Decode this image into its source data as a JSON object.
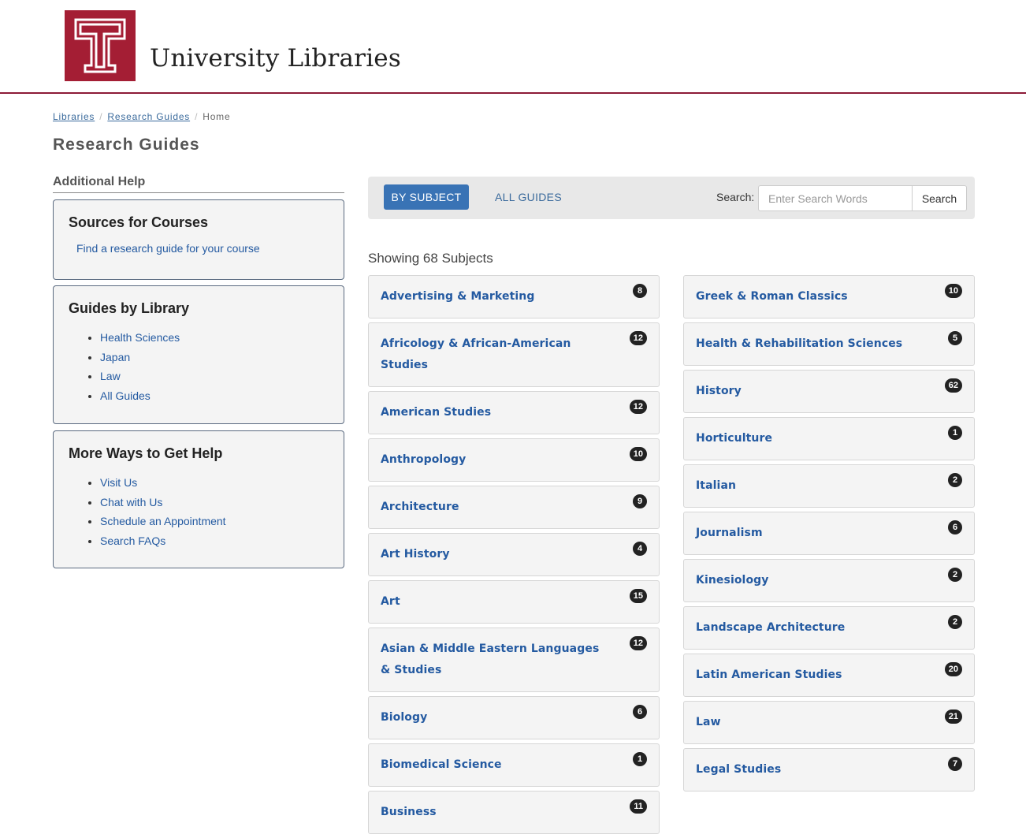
{
  "header": {
    "site_title": "University Libraries",
    "brand_color": "#a41e34",
    "rule_color": "#8c1b37"
  },
  "breadcrumb": {
    "items": [
      "Libraries",
      "Research Guides"
    ],
    "current": "Home"
  },
  "page_title": "Research Guides",
  "sidebar": {
    "heading": "Additional Help",
    "sources": {
      "title": "Sources for Courses",
      "link": "Find a research guide for your course"
    },
    "guides_by_library": {
      "title": "Guides by Library",
      "items": [
        "Health Sciences",
        "Japan",
        "Law",
        "All Guides"
      ]
    },
    "more_help": {
      "title": "More Ways to Get Help",
      "items": [
        "Visit Us",
        "Chat with Us",
        "Schedule an Appointment",
        "Search FAQs"
      ]
    }
  },
  "toolbar": {
    "tab_by_subject": "BY SUBJECT",
    "tab_all_guides": "ALL GUIDES",
    "search_label": "Search:",
    "search_placeholder": "Enter Search Words",
    "search_button": "Search",
    "active_color": "#3973b5"
  },
  "showing": "Showing 68 Subjects",
  "subjects_left": [
    {
      "name": "Advertising & Marketing",
      "count": "8"
    },
    {
      "name": "Africology & African-American Studies",
      "count": "12"
    },
    {
      "name": "American Studies",
      "count": "12"
    },
    {
      "name": "Anthropology",
      "count": "10"
    },
    {
      "name": "Architecture",
      "count": "9"
    },
    {
      "name": "Art History",
      "count": "4"
    },
    {
      "name": "Art",
      "count": "15"
    },
    {
      "name": "Asian & Middle Eastern Languages & Studies",
      "count": "12"
    },
    {
      "name": "Biology",
      "count": "6"
    },
    {
      "name": "Biomedical Science",
      "count": "1"
    },
    {
      "name": "Business",
      "count": "11"
    }
  ],
  "subjects_right": [
    {
      "name": "Greek & Roman Classics",
      "count": "10"
    },
    {
      "name": "Health & Rehabilitation Sciences",
      "count": "5"
    },
    {
      "name": "History",
      "count": "62"
    },
    {
      "name": "Horticulture",
      "count": "1"
    },
    {
      "name": "Italian",
      "count": "2"
    },
    {
      "name": "Journalism",
      "count": "6"
    },
    {
      "name": "Kinesiology",
      "count": "2"
    },
    {
      "name": "Landscape Architecture",
      "count": "2"
    },
    {
      "name": "Latin American Studies",
      "count": "20"
    },
    {
      "name": "Law",
      "count": "21"
    },
    {
      "name": "Legal Studies",
      "count": "7"
    }
  ]
}
